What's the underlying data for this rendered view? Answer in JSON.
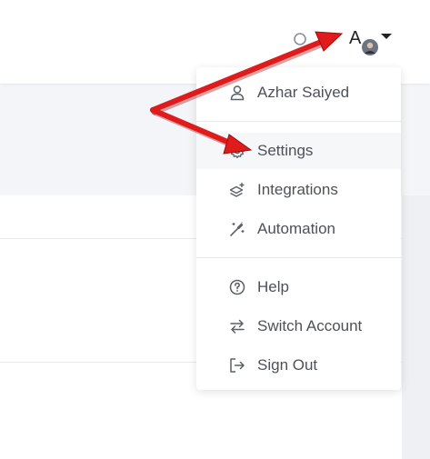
{
  "header": {
    "avatar_letter": "A"
  },
  "menu": {
    "groups": [
      [
        {
          "label": "Azhar Saiyed",
          "icon": "user-icon"
        }
      ],
      [
        {
          "label": "Settings",
          "icon": "gear-icon"
        },
        {
          "label": "Integrations",
          "icon": "integrations-icon"
        },
        {
          "label": "Automation",
          "icon": "magic-wand-icon"
        }
      ],
      [
        {
          "label": "Help",
          "icon": "help-icon"
        },
        {
          "label": "Switch Account",
          "icon": "switch-icon"
        },
        {
          "label": "Sign Out",
          "icon": "sign-out-icon"
        }
      ]
    ]
  },
  "colors": {
    "annotation_arrow": "#e01b1b",
    "text": "#4d5158"
  }
}
